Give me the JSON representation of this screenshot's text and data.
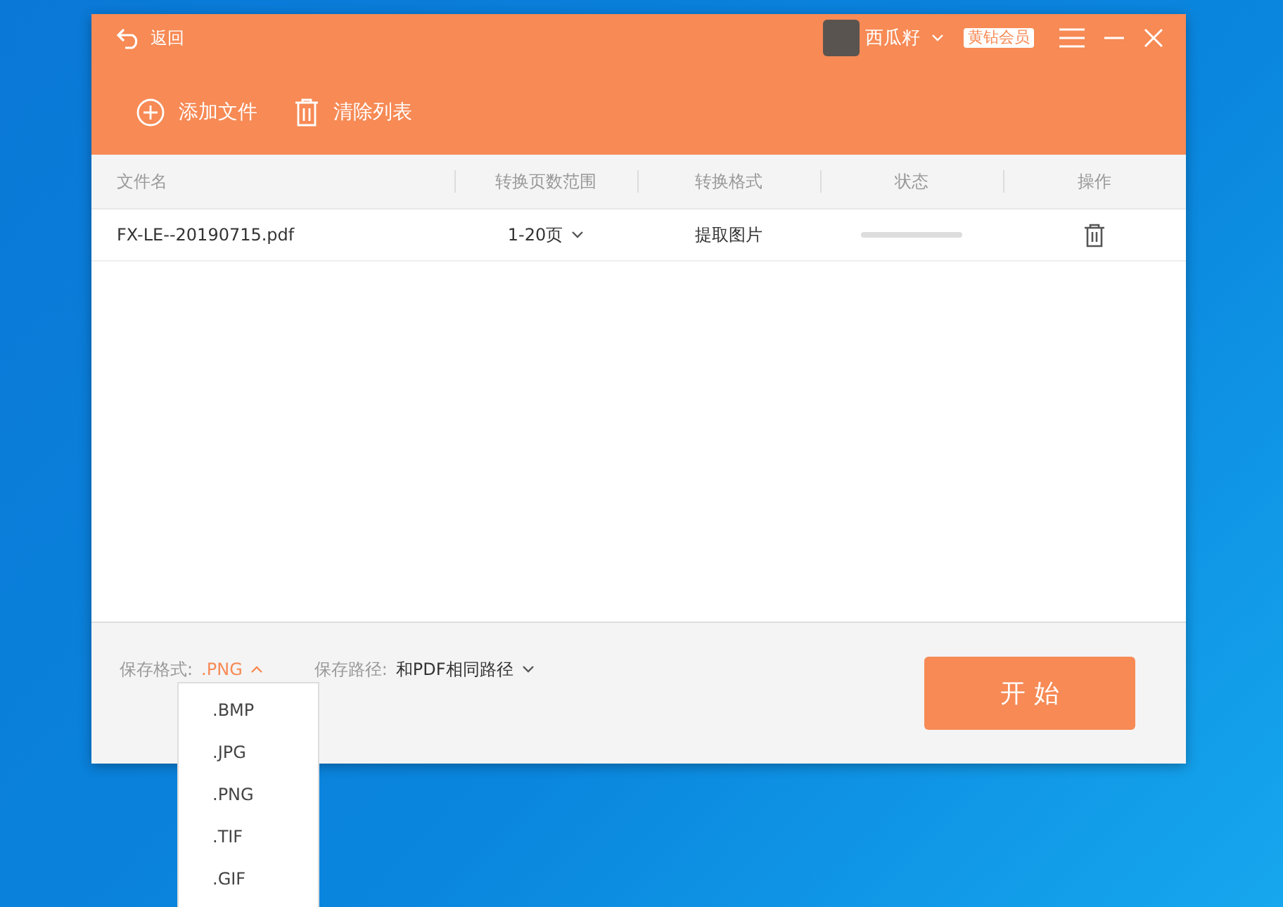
{
  "titlebar": {
    "back_label": "返回",
    "user_name": "西瓜籽",
    "vip_badge": "黄钻会员"
  },
  "toolbar": [
    "添加文件",
    "清除列表"
  ],
  "table": {
    "columns": [
      "文件名",
      "转换页数范围",
      "转换格式",
      "状态",
      "操作"
    ],
    "rows": [
      {
        "file": "FX-LE--20190715.pdf",
        "page_range": "1-20页",
        "format": "提取图片",
        "level": 0
      }
    ]
  },
  "footer": {
    "format_label": "保存格式:",
    "format_value": ".PNG",
    "format_expanded": true,
    "path_label": "保存路径:",
    "path_value": "和PDF相同路径",
    "start_button": "开 始"
  },
  "format_options": [
    ".BMP",
    ".JPG",
    ".PNG",
    ".TIF",
    ".GIF"
  ]
}
